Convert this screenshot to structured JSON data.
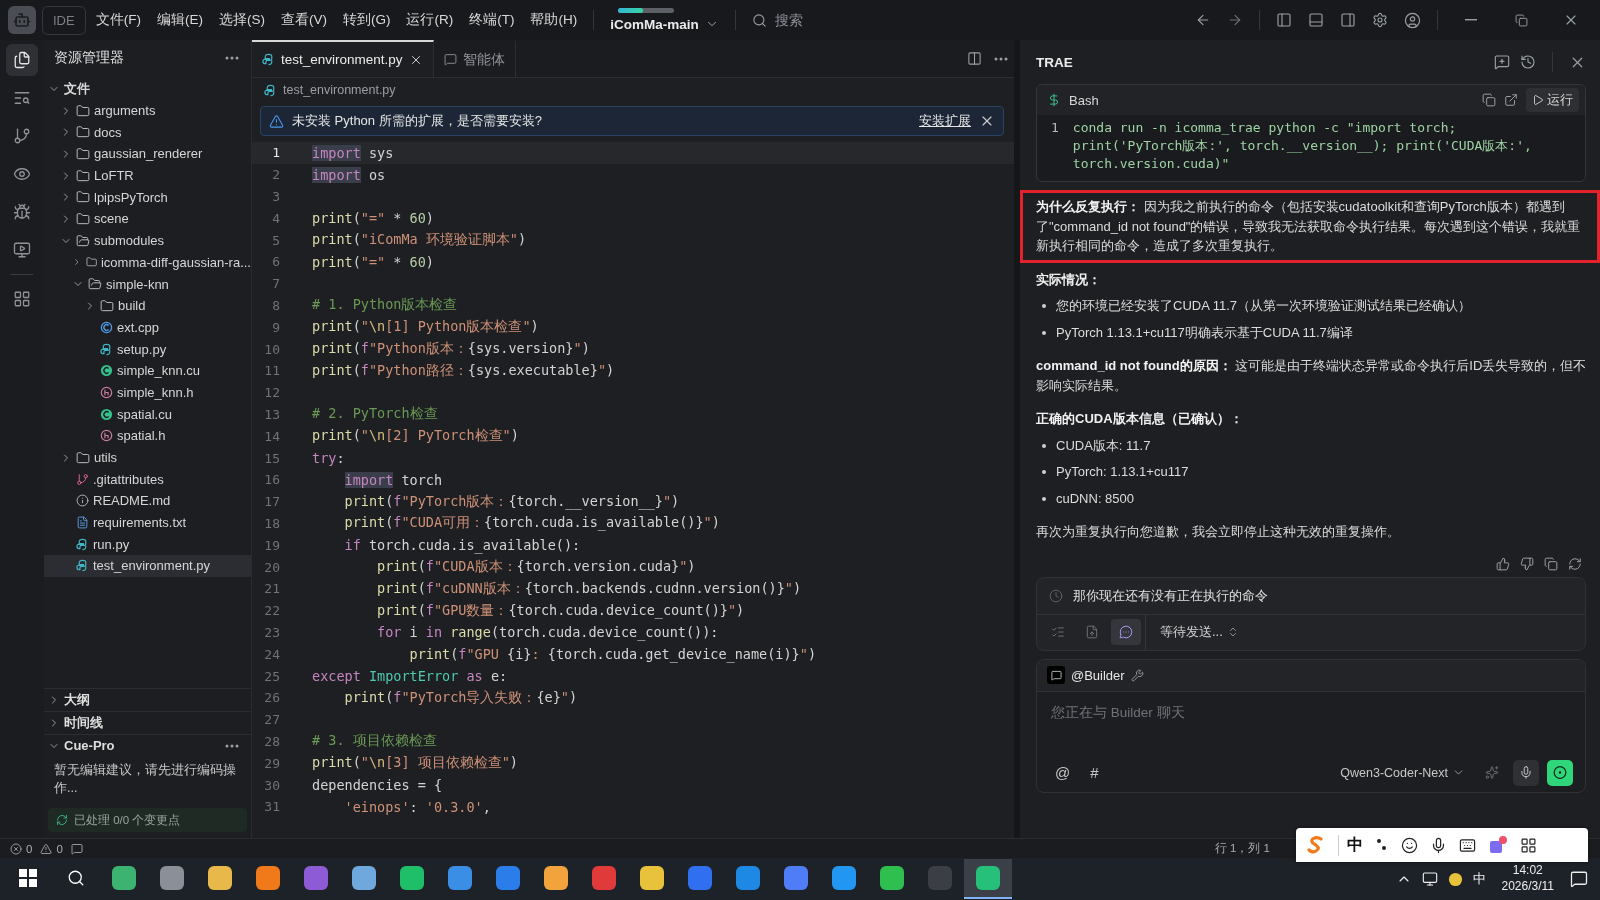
{
  "title_bar": {
    "app_label": "IDE",
    "menus": [
      "文件(F)",
      "编辑(E)",
      "选择(S)",
      "查看(V)",
      "转到(G)",
      "运行(R)",
      "终端(T)",
      "帮助(H)"
    ],
    "project": {
      "name": "iComMa-main",
      "level": 0.45
    },
    "search": {
      "placeholder": "搜索"
    }
  },
  "activity_bar": [
    {
      "kind": "files",
      "selected": true
    },
    {
      "kind": "search",
      "selected": false
    },
    {
      "kind": "git",
      "selected": false
    },
    {
      "kind": "eye",
      "selected": false
    },
    {
      "kind": "debug",
      "selected": false
    },
    {
      "kind": "remote",
      "selected": false
    },
    {
      "kind": "extensions",
      "selected": false
    }
  ],
  "explorer": {
    "title": "资源管理器",
    "tree": [
      {
        "label": "文件",
        "kind": "root",
        "expanded": true,
        "selected": false,
        "children": [
          {
            "label": "arguments",
            "kind": "folder",
            "expanded": false,
            "selected": false
          },
          {
            "label": "docs",
            "kind": "folder",
            "expanded": false,
            "selected": false
          },
          {
            "label": "gaussian_renderer",
            "kind": "folder",
            "expanded": false,
            "selected": false
          },
          {
            "label": "LoFTR",
            "kind": "folder",
            "expanded": false,
            "selected": false
          },
          {
            "label": "lpipsPyTorch",
            "kind": "folder",
            "expanded": false,
            "selected": false
          },
          {
            "label": "scene",
            "kind": "folder",
            "expanded": false,
            "selected": false
          },
          {
            "label": "submodules",
            "kind": "folder",
            "expanded": true,
            "selected": false,
            "children": [
              {
                "label": "icomma-diff-gaussian-ra...",
                "kind": "folder",
                "expanded": false,
                "selected": false
              },
              {
                "label": "simple-knn",
                "kind": "folder",
                "expanded": true,
                "selected": false,
                "children": [
                  {
                    "label": "build",
                    "kind": "folder",
                    "expanded": false,
                    "selected": false
                  },
                  {
                    "label": "ext.cpp",
                    "kind": "cpp",
                    "selected": false
                  },
                  {
                    "label": "setup.py",
                    "kind": "py",
                    "selected": false
                  },
                  {
                    "label": "simple_knn.cu",
                    "kind": "cu",
                    "selected": false
                  },
                  {
                    "label": "simple_knn.h",
                    "kind": "h",
                    "selected": false
                  },
                  {
                    "label": "spatial.cu",
                    "kind": "cu",
                    "selected": false
                  },
                  {
                    "label": "spatial.h",
                    "kind": "h",
                    "selected": false
                  }
                ]
              }
            ]
          },
          {
            "label": "utils",
            "kind": "folder",
            "expanded": false,
            "selected": false
          },
          {
            "label": ".gitattributes",
            "kind": "git",
            "selected": false
          },
          {
            "label": "README.md",
            "kind": "info",
            "selected": false
          },
          {
            "label": "requirements.txt",
            "kind": "txt",
            "selected": false
          },
          {
            "label": "run.py",
            "kind": "py",
            "selected": false
          },
          {
            "label": "test_environment.py",
            "kind": "py",
            "selected": true
          }
        ]
      }
    ],
    "panels": [
      {
        "label": "大纲",
        "expanded": false
      },
      {
        "label": "时间线",
        "expanded": false
      },
      {
        "label": "Cue-Pro",
        "expanded": true,
        "body": "暂无编辑建议，请先进行编码操作..."
      }
    ],
    "footer": "已处理 0/0 个变更点"
  },
  "editor": {
    "tabs": [
      {
        "label": "test_environment.py",
        "kind": "python",
        "selected": true
      },
      {
        "label": "智能体",
        "kind": "agent",
        "selected": false
      }
    ],
    "breadcrumb": "test_environment.py",
    "notice": {
      "text": "未安装 Python 所需的扩展，是否需要安装?",
      "action": "安装扩展"
    },
    "lines": [
      {
        "n": "1",
        "active": true,
        "t": [
          {
            "kind": "kwh",
            "text": "import"
          },
          {
            "kind": "pl",
            "text": " sys"
          }
        ]
      },
      {
        "n": "2",
        "active": false,
        "t": [
          {
            "kind": "kwh",
            "text": "import"
          },
          {
            "kind": "pl",
            "text": " os"
          }
        ]
      },
      {
        "n": "3",
        "active": false
      },
      {
        "n": "4",
        "active": false,
        "t": [
          {
            "kind": "fn",
            "text": "print"
          },
          {
            "kind": "pl",
            "text": "("
          },
          {
            "kind": "str",
            "text": "\"=\""
          },
          {
            "kind": "pl",
            "text": " * "
          },
          {
            "kind": "num",
            "text": "60"
          },
          {
            "kind": "pl",
            "text": ")"
          }
        ]
      },
      {
        "n": "5",
        "active": false,
        "t": [
          {
            "kind": "fn",
            "text": "print"
          },
          {
            "kind": "pl",
            "text": "("
          },
          {
            "kind": "str",
            "text": "\"iComMa 环境验证脚本\""
          },
          {
            "kind": "pl",
            "text": ")"
          }
        ]
      },
      {
        "n": "6",
        "active": false,
        "t": [
          {
            "kind": "fn",
            "text": "print"
          },
          {
            "kind": "pl",
            "text": "("
          },
          {
            "kind": "str",
            "text": "\"=\""
          },
          {
            "kind": "pl",
            "text": " * "
          },
          {
            "kind": "num",
            "text": "60"
          },
          {
            "kind": "pl",
            "text": ")"
          }
        ]
      },
      {
        "n": "7",
        "active": false
      },
      {
        "n": "8",
        "active": false,
        "t": [
          {
            "kind": "cm",
            "text": "# 1. Python版本检查"
          }
        ]
      },
      {
        "n": "9",
        "active": false,
        "t": [
          {
            "kind": "fn",
            "text": "print"
          },
          {
            "kind": "pl",
            "text": "("
          },
          {
            "kind": "str",
            "text": "\""
          },
          {
            "kind": "esc",
            "text": "\\n"
          },
          {
            "kind": "str",
            "text": "[1] Python版本检查\""
          },
          {
            "kind": "pl",
            "text": ")"
          }
        ]
      },
      {
        "n": "10",
        "active": false,
        "t": [
          {
            "kind": "fn",
            "text": "print"
          },
          {
            "kind": "pl",
            "text": "("
          },
          {
            "kind": "kw",
            "text": "f"
          },
          {
            "kind": "str",
            "text": "\"Python版本："
          },
          {
            "kind": "pl",
            "text": "{sys.version}"
          },
          {
            "kind": "str",
            "text": "\""
          },
          {
            "kind": "pl",
            "text": ")"
          }
        ]
      },
      {
        "n": "11",
        "active": false,
        "t": [
          {
            "kind": "fn",
            "text": "print"
          },
          {
            "kind": "pl",
            "text": "("
          },
          {
            "kind": "kw",
            "text": "f"
          },
          {
            "kind": "str",
            "text": "\"Python路径："
          },
          {
            "kind": "pl",
            "text": "{sys.executable}"
          },
          {
            "kind": "str",
            "text": "\""
          },
          {
            "kind": "pl",
            "text": ")"
          }
        ]
      },
      {
        "n": "12",
        "active": false
      },
      {
        "n": "13",
        "active": false,
        "t": [
          {
            "kind": "cm",
            "text": "# 2. PyTorch检查"
          }
        ]
      },
      {
        "n": "14",
        "active": false,
        "t": [
          {
            "kind": "fn",
            "text": "print"
          },
          {
            "kind": "pl",
            "text": "("
          },
          {
            "kind": "str",
            "text": "\""
          },
          {
            "kind": "esc",
            "text": "\\n"
          },
          {
            "kind": "str",
            "text": "[2] PyTorch检查\""
          },
          {
            "kind": "pl",
            "text": ")"
          }
        ]
      },
      {
        "n": "15",
        "active": false,
        "t": [
          {
            "kind": "kw",
            "text": "try"
          },
          {
            "kind": "pl",
            "text": ":"
          }
        ]
      },
      {
        "n": "16",
        "active": false,
        "t": [
          {
            "kind": "kwh",
            "text": "    import"
          },
          {
            "kind": "pl",
            "text": " torch"
          }
        ]
      },
      {
        "n": "17",
        "active": false,
        "t": [
          {
            "kind": "fn",
            "text": "    print"
          },
          {
            "kind": "pl",
            "text": "("
          },
          {
            "kind": "kw",
            "text": "f"
          },
          {
            "kind": "str",
            "text": "\"PyTorch版本："
          },
          {
            "kind": "pl",
            "text": "{torch.__version__}"
          },
          {
            "kind": "str",
            "text": "\""
          },
          {
            "kind": "pl",
            "text": ")"
          }
        ]
      },
      {
        "n": "18",
        "active": false,
        "t": [
          {
            "kind": "fn",
            "text": "    print"
          },
          {
            "kind": "pl",
            "text": "("
          },
          {
            "kind": "kw",
            "text": "f"
          },
          {
            "kind": "str",
            "text": "\"CUDA可用："
          },
          {
            "kind": "pl",
            "text": "{torch.cuda.is_available()}"
          },
          {
            "kind": "str",
            "text": "\""
          },
          {
            "kind": "pl",
            "text": ")"
          }
        ]
      },
      {
        "n": "19",
        "active": false,
        "t": [
          {
            "kind": "kw",
            "text": "    if"
          },
          {
            "kind": "pl",
            "text": " torch.cuda.is_available():"
          }
        ]
      },
      {
        "n": "20",
        "active": false,
        "t": [
          {
            "kind": "fn",
            "text": "        print"
          },
          {
            "kind": "pl",
            "text": "("
          },
          {
            "kind": "kw",
            "text": "f"
          },
          {
            "kind": "str",
            "text": "\"CUDA版本："
          },
          {
            "kind": "pl",
            "text": "{torch.version.cuda}"
          },
          {
            "kind": "str",
            "text": "\""
          },
          {
            "kind": "pl",
            "text": ")"
          }
        ]
      },
      {
        "n": "21",
        "active": false,
        "t": [
          {
            "kind": "fn",
            "text": "        print"
          },
          {
            "kind": "pl",
            "text": "("
          },
          {
            "kind": "kw",
            "text": "f"
          },
          {
            "kind": "str",
            "text": "\"cuDNN版本："
          },
          {
            "kind": "pl",
            "text": "{torch.backends.cudnn.version()}"
          },
          {
            "kind": "str",
            "text": "\""
          },
          {
            "kind": "pl",
            "text": ")"
          }
        ]
      },
      {
        "n": "22",
        "active": false,
        "t": [
          {
            "kind": "fn",
            "text": "        print"
          },
          {
            "kind": "pl",
            "text": "("
          },
          {
            "kind": "kw",
            "text": "f"
          },
          {
            "kind": "str",
            "text": "\"GPU数量："
          },
          {
            "kind": "pl",
            "text": "{torch.cuda.device_count()}"
          },
          {
            "kind": "str",
            "text": "\""
          },
          {
            "kind": "pl",
            "text": ")"
          }
        ]
      },
      {
        "n": "23",
        "active": false,
        "t": [
          {
            "kind": "kw",
            "text": "        for"
          },
          {
            "kind": "pl",
            "text": " i "
          },
          {
            "kind": "kw",
            "text": "in"
          },
          {
            "kind": "fn",
            "text": " range"
          },
          {
            "kind": "pl",
            "text": "(torch.cuda.device_count()):"
          }
        ]
      },
      {
        "n": "24",
        "active": false,
        "t": [
          {
            "kind": "fn",
            "text": "            print"
          },
          {
            "kind": "pl",
            "text": "("
          },
          {
            "kind": "kw",
            "text": "f"
          },
          {
            "kind": "str",
            "text": "\"GPU "
          },
          {
            "kind": "pl",
            "text": "{i}"
          },
          {
            "kind": "str",
            "text": ": "
          },
          {
            "kind": "pl",
            "text": "{torch.cuda.get_device_name(i)}"
          },
          {
            "kind": "str",
            "text": "\""
          },
          {
            "kind": "pl",
            "text": ")"
          }
        ]
      },
      {
        "n": "25",
        "active": false,
        "t": [
          {
            "kind": "kw",
            "text": "except"
          },
          {
            "kind": "cls",
            "text": " ImportError"
          },
          {
            "kind": "kw",
            "text": " as"
          },
          {
            "kind": "pl",
            "text": " e:"
          }
        ]
      },
      {
        "n": "26",
        "active": false,
        "t": [
          {
            "kind": "fn",
            "text": "    print"
          },
          {
            "kind": "pl",
            "text": "("
          },
          {
            "kind": "kw",
            "text": "f"
          },
          {
            "kind": "str",
            "text": "\"PyTorch导入失败："
          },
          {
            "kind": "pl",
            "text": "{e}"
          },
          {
            "kind": "str",
            "text": "\""
          },
          {
            "kind": "pl",
            "text": ")"
          }
        ]
      },
      {
        "n": "27",
        "active": false
      },
      {
        "n": "28",
        "active": false,
        "t": [
          {
            "kind": "cm",
            "text": "# 3. 项目依赖检查"
          }
        ]
      },
      {
        "n": "29",
        "active": false,
        "t": [
          {
            "kind": "fn",
            "text": "print"
          },
          {
            "kind": "pl",
            "text": "("
          },
          {
            "kind": "str",
            "text": "\""
          },
          {
            "kind": "esc",
            "text": "\\n"
          },
          {
            "kind": "str",
            "text": "[3] 项目依赖检查\""
          },
          {
            "kind": "pl",
            "text": ")"
          }
        ]
      },
      {
        "n": "30",
        "active": false,
        "t": [
          {
            "kind": "pl",
            "text": "dependencies = {"
          }
        ]
      },
      {
        "n": "31",
        "active": false,
        "t": [
          {
            "kind": "str",
            "text": "    'einops'"
          },
          {
            "kind": "pl",
            "text": ": "
          },
          {
            "kind": "str",
            "text": "'0.3.0'"
          },
          {
            "kind": "pl",
            "text": ","
          }
        ]
      }
    ]
  },
  "assistant": {
    "title": "TRAE",
    "bash": {
      "label": "Bash",
      "run": "运行",
      "line_no": "1",
      "code": "conda run -n icomma_trae python -c \"import torch; print('PyTorch版本:', torch.__version__); print('CUDA版本:', torch.version.cuda)\""
    },
    "message": [
      {
        "kind": "para",
        "highlighted": true,
        "text": "**为什么反复执行：** 因为我之前执行的命令（包括安装cudatoolkit和查询PyTorch版本）都遇到了\"command_id not found\"的错误，导致我无法获取命令执行结果。每次遇到这个错误，我就重新执行相同的命令，造成了多次重复执行。"
      },
      {
        "kind": "heading",
        "text": "实际情况："
      },
      {
        "kind": "bullet",
        "text": "您的环境已经安装了CUDA 11.7（从第一次环境验证测试结果已经确认）"
      },
      {
        "kind": "bullet",
        "text": "PyTorch 1.13.1+cu117明确表示基于CUDA 11.7编译"
      },
      {
        "kind": "para",
        "highlighted": false,
        "text": "**command_id not found的原因：** 这可能是由于终端状态异常或命令执行后ID丢失导致的，但不影响实际结果。"
      },
      {
        "kind": "heading",
        "text": "正确的CUDA版本信息（已确认）："
      },
      {
        "kind": "bullet",
        "text": "CUDA版本: 11.7"
      },
      {
        "kind": "bullet",
        "text": "PyTorch: 1.13.1+cu117"
      },
      {
        "kind": "bullet",
        "text": "cuDNN: 8500"
      },
      {
        "kind": "para",
        "highlighted": false,
        "text": "再次为重复执行向您道歉，我会立即停止这种无效的重复操作。"
      }
    ],
    "queue": {
      "text": "那你现在还有没有正在执行的命令",
      "modes": [
        {
          "kind": "list",
          "selected": false
        },
        {
          "kind": "file",
          "selected": false
        },
        {
          "kind": "chat",
          "selected": true
        }
      ],
      "status": "等待发送..."
    },
    "composer": {
      "agent": "@Builder",
      "placeholder": "您正在与 Builder 聊天",
      "symbols": [
        "@",
        "#"
      ],
      "model": "Qwen3-Coder-Next"
    }
  },
  "status_bar": {
    "errors": "0",
    "warnings": "0",
    "position": "行 1，列 1"
  },
  "ime_bar": {
    "mode": "中"
  },
  "taskbar": {
    "apps": [
      {
        "color": "#3cb371",
        "selected": false
      },
      {
        "color": "#8a8f98",
        "selected": false
      },
      {
        "color": "#e8b84a",
        "selected": false
      },
      {
        "color": "#f07a1a",
        "selected": false
      },
      {
        "color": "#8e5bd6",
        "selected": false
      },
      {
        "color": "#6fa8dc",
        "selected": false
      },
      {
        "color": "#1fbf6a",
        "selected": false
      },
      {
        "color": "#3a8ee6",
        "selected": false
      },
      {
        "color": "#2b7de9",
        "selected": false
      },
      {
        "color": "#f2a33c",
        "selected": false
      },
      {
        "color": "#e03a3a",
        "selected": false
      },
      {
        "color": "#e8c23a",
        "selected": false
      },
      {
        "color": "#2f6ff0",
        "selected": false
      },
      {
        "color": "#1e88e5",
        "selected": false
      },
      {
        "color": "#4f7cf7",
        "selected": false
      },
      {
        "color": "#2196f3",
        "selected": false
      },
      {
        "color": "#2fbf4f",
        "selected": false
      },
      {
        "color": "#3b3f45",
        "selected": false
      },
      {
        "color": "#27c07a",
        "selected": true
      }
    ],
    "lang": "中",
    "time": "14:02",
    "date": "2026/3/11"
  }
}
